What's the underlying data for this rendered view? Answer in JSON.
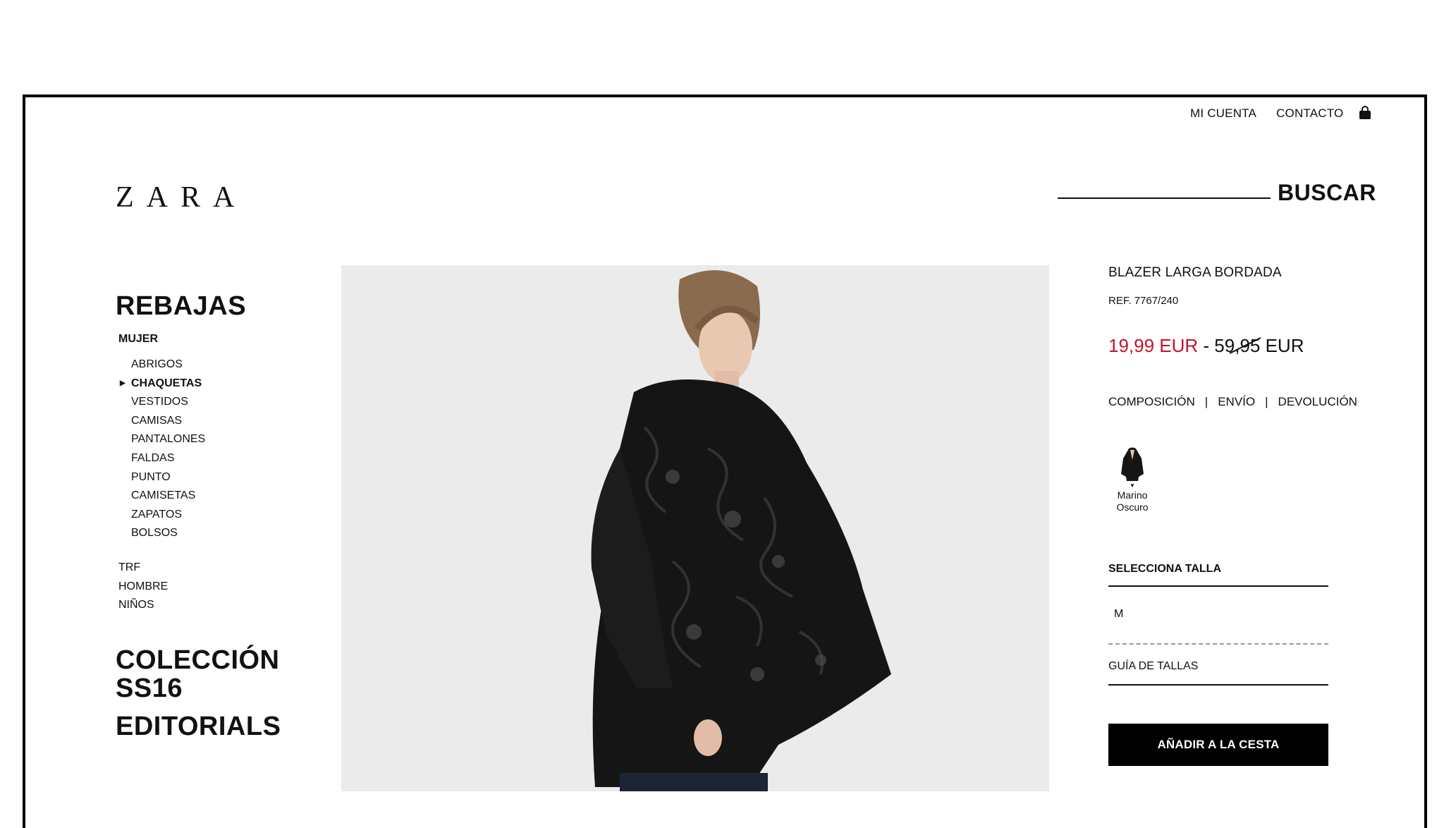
{
  "header": {
    "account_label": "MI CUENTA",
    "contact_label": "CONTACTO",
    "logo_text": "ZARA",
    "search_label": "BUSCAR"
  },
  "sidebar": {
    "section_title": "REBAJAS",
    "group_label": "MUJER",
    "categories": [
      "ABRIGOS",
      "CHAQUETAS",
      "VESTIDOS",
      "CAMISAS",
      "PANTALONES",
      "FALDAS",
      "PUNTO",
      "CAMISETAS",
      "ZAPATOS",
      "BOLSOS"
    ],
    "active_category": "CHAQUETAS",
    "other_sections": [
      "TRF",
      "HOMBRE",
      "NIÑOS"
    ],
    "collection_line1": "COLECCIÓN",
    "collection_line2": "SS16",
    "editorials": "EDITORIALS"
  },
  "product": {
    "name": "BLAZER LARGA BORDADA",
    "ref": "REF. 7767/240",
    "sale_price": "19,99 EUR",
    "price_separator": " - ",
    "original_price": "59,95 EUR",
    "links": [
      "COMPOSICIÓN",
      "ENVÍO",
      "DEVOLUCIÓN"
    ],
    "link_separator": "|",
    "color_label_line1": "Marino",
    "color_label_line2": "Oscuro",
    "size_title": "SELECCIONA TALLA",
    "selected_size": "M",
    "size_guide": "GUÍA DE TALLAS",
    "add_to_cart": "AÑADIR A LA CESTA"
  },
  "colors": {
    "sale": "#c8102e",
    "button_bg": "#000000",
    "photo_bg": "#ebebeb"
  },
  "icons": {
    "cart": "shopping-bag-icon",
    "active_arrow": "triangle-right-icon",
    "swatch_pointer": "triangle-down-icon"
  }
}
